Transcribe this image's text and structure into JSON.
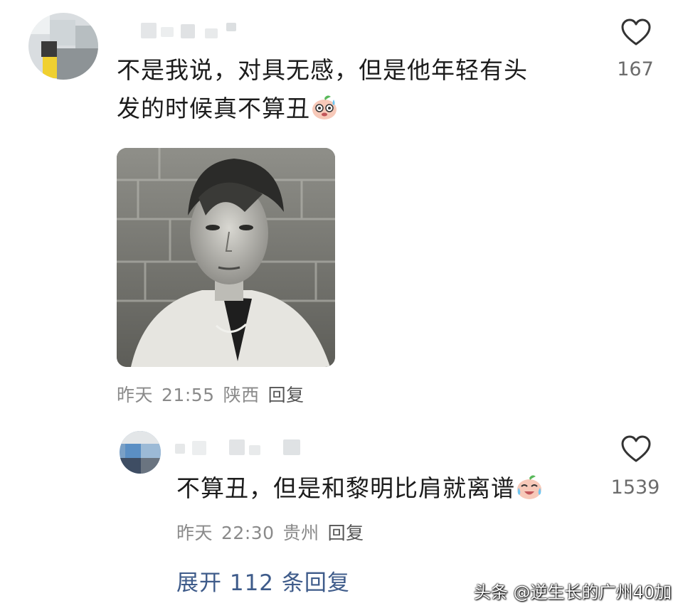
{
  "comment": {
    "line1": "不是我说，对具无感，但是他年轻有头",
    "line2": "发的时候真不算丑",
    "emoji": "sweat-face-emoji",
    "likes": "167",
    "time_day": "昨天",
    "time": "21:55",
    "location": "陕西",
    "reply_label": "回复"
  },
  "reply": {
    "text": "不算丑，但是和黎明比肩就离谱",
    "emoji": "crying-laughing-emoji",
    "likes": "1539",
    "time_day": "昨天",
    "time": "22:30",
    "location": "贵州",
    "reply_label": "回复"
  },
  "expand": {
    "label": "展开 112 条回复"
  },
  "watermark": "头条 @逆生长的广州40加"
}
